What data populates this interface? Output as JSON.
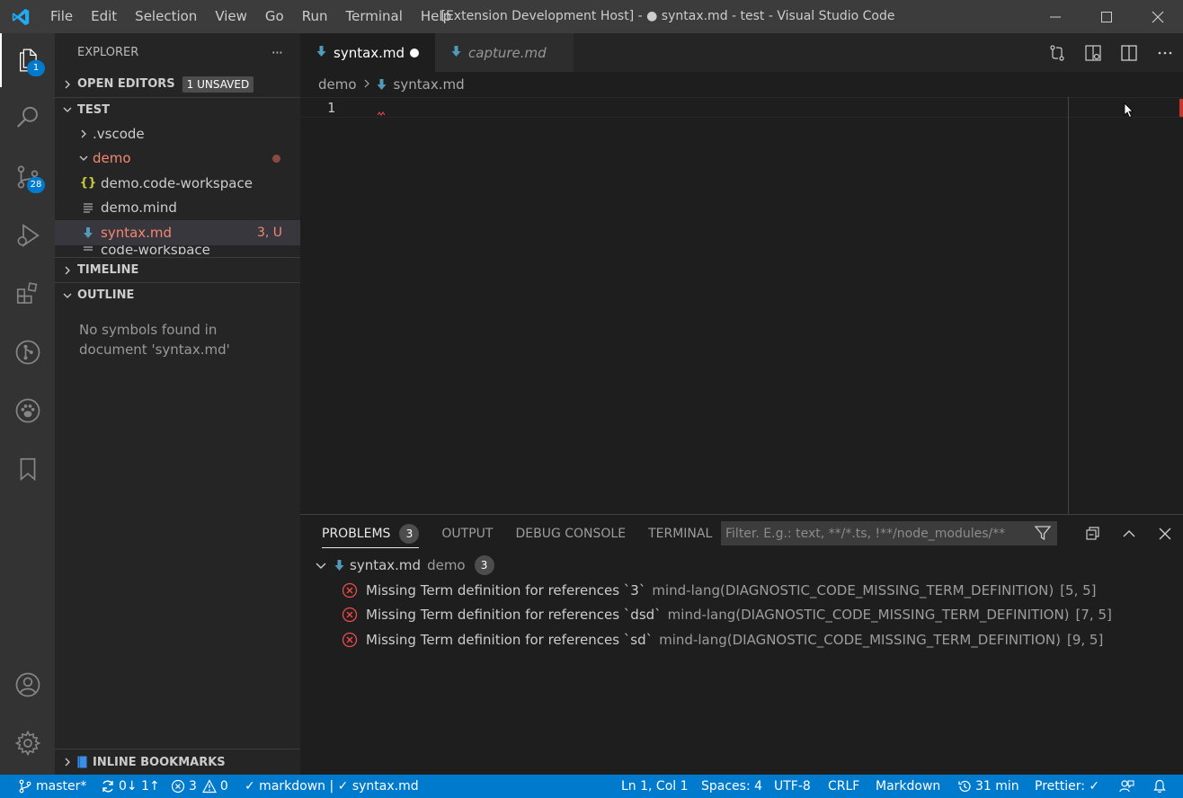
{
  "window": {
    "title": "[Extension Development Host] - ● syntax.md - test - Visual Studio Code",
    "menu": [
      "File",
      "Edit",
      "Selection",
      "View",
      "Go",
      "Run",
      "Terminal",
      "Help"
    ]
  },
  "activity_bar": {
    "explorer_badge": "1",
    "scm_badge": "28"
  },
  "sidebar": {
    "title": "EXPLORER",
    "more": "···",
    "open_editors": {
      "label": "OPEN EDITORS",
      "badge": "1 UNSAVED"
    },
    "workspace": "TEST",
    "tree": [
      {
        "label": ".vscode",
        "kind": "folder-collapsed"
      },
      {
        "label": "demo",
        "kind": "folder-open"
      },
      {
        "label": "demo.code-workspace",
        "kind": "json"
      },
      {
        "label": "demo.mind",
        "kind": "text"
      },
      {
        "label": "syntax.md",
        "kind": "markdown",
        "decoration": "3, U"
      }
    ],
    "partial_row": "code-workspace",
    "timeline": "TIMELINE",
    "outline": "OUTLINE",
    "outline_message": [
      "No symbols found in",
      "document 'syntax.md'"
    ],
    "bookmarks": "INLINE BOOKMARKS"
  },
  "tabs": [
    {
      "label": "syntax.md",
      "active": true,
      "dirty": true
    },
    {
      "label": "capture.md",
      "active": false,
      "preview": true
    }
  ],
  "breadcrumbs": [
    "demo",
    "syntax.md"
  ],
  "editor": {
    "line_numbers": [
      "1"
    ]
  },
  "panel": {
    "tabs": [
      {
        "label": "PROBLEMS",
        "count": "3",
        "active": true
      },
      {
        "label": "OUTPUT"
      },
      {
        "label": "DEBUG CONSOLE"
      },
      {
        "label": "TERMINAL"
      }
    ],
    "filter_placeholder": "Filter. E.g.: text, **/*.ts, !**/node_modules/**",
    "file": {
      "name": "syntax.md",
      "folder": "demo",
      "count": "3"
    },
    "problems": [
      {
        "message": "Missing Term definition for references `3`",
        "source": "mind-lang(DIAGNOSTIC_CODE_MISSING_TERM_DEFINITION)",
        "location": "[5, 5]"
      },
      {
        "message": "Missing Term definition for references `dsd`",
        "source": "mind-lang(DIAGNOSTIC_CODE_MISSING_TERM_DEFINITION)",
        "location": "[7, 5]"
      },
      {
        "message": "Missing Term definition for references `sd`",
        "source": "mind-lang(DIAGNOSTIC_CODE_MISSING_TERM_DEFINITION)",
        "location": "[9, 5]"
      }
    ]
  },
  "status_bar": {
    "branch": "master*",
    "sync": "0↓ 1↑",
    "errors": "3",
    "warnings": "0",
    "lint": "✓ markdown | ✓ syntax.md",
    "position": "Ln 1, Col 1",
    "spaces": "Spaces: 4",
    "encoding": "UTF-8",
    "eol": "CRLF",
    "language": "Markdown",
    "time": "31 min",
    "prettier": "Prettier: ✓"
  },
  "colors": {
    "accent": "#007acc",
    "error": "#f14c4c",
    "modified": "#f48771"
  }
}
